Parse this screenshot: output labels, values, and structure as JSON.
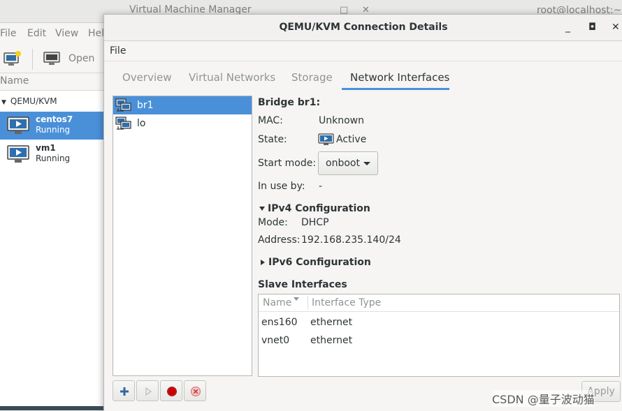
{
  "vmm": {
    "title": "Virtual Machine Manager",
    "menu": [
      "File",
      "Edit",
      "View",
      "Hel"
    ],
    "toolbar_open": "Open",
    "list_header": "Name",
    "connection": "QEMU/KVM",
    "vms": [
      {
        "name": "centos7",
        "status": "Running",
        "selected": true
      },
      {
        "name": "vm1",
        "status": "Running",
        "selected": false
      }
    ]
  },
  "terminal_title": "root@localhost:~",
  "dialog": {
    "title": "QEMU/KVM Connection Details",
    "menu_file": "File",
    "tabs": [
      {
        "label": "Overview",
        "active": false
      },
      {
        "label": "Virtual Networks",
        "active": false
      },
      {
        "label": "Storage",
        "active": false
      },
      {
        "label": "Network Interfaces",
        "active": true
      }
    ],
    "interfaces": [
      {
        "name": "br1",
        "selected": true
      },
      {
        "name": "lo",
        "selected": false
      }
    ],
    "details": {
      "heading": "Bridge br1:",
      "mac_label": "MAC:",
      "mac_value": "Unknown",
      "state_label": "State:",
      "state_value": "Active",
      "start_mode_label": "Start mode:",
      "start_mode_value": "onboot",
      "in_use_label": "In use by:",
      "in_use_value": "-",
      "ipv4_heading": "IPv4 Configuration",
      "ipv4_mode_label": "Mode:",
      "ipv4_mode_value": "DHCP",
      "ipv4_address_label": "Address:",
      "ipv4_address_value": "192.168.235.140/24",
      "ipv6_heading": "IPv6 Configuration",
      "slave_heading": "Slave Interfaces",
      "slave_columns": [
        "Name",
        "Interface Type"
      ],
      "slaves": [
        {
          "name": "ens160",
          "type": "ethernet"
        },
        {
          "name": "vnet0",
          "type": "ethernet"
        }
      ]
    },
    "apply_label": "Apply"
  },
  "watermark": "CSDN @量子波动猫",
  "colors": {
    "selection": "#4a90d9",
    "text": "#2e3436",
    "dim_text": "#919494",
    "record_red": "#cc0000",
    "add_blue": "#3465a4"
  },
  "icons": {
    "new_vm": "new-vm-icon",
    "open": "monitor-icon",
    "vm": "vm-monitor-icon",
    "interface": "network-interface-icon",
    "add": "plus-icon",
    "start": "play-icon",
    "stop": "record-icon",
    "delete": "delete-icon"
  }
}
